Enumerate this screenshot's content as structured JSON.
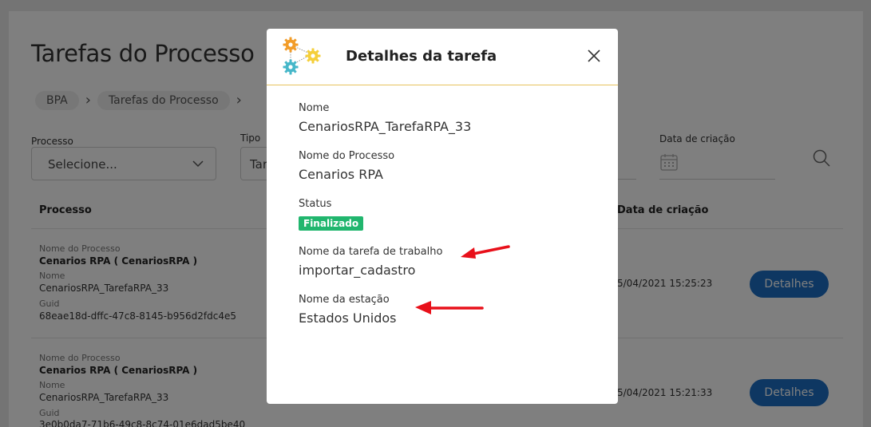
{
  "page": {
    "title": "Tarefas do Processo",
    "breadcrumb": [
      "BPA",
      "Tarefas do Processo"
    ],
    "filters": {
      "processo_label": "Processo",
      "processo_value": "Selecione...",
      "tipo_label": "Tipo",
      "tipo_value": "Tar",
      "data_label": "Data de criação"
    },
    "table": {
      "headers": {
        "processo": "Processo",
        "data": "Data de criação"
      },
      "rows": [
        {
          "nome_processo_label": "Nome do Processo",
          "nome_processo": "Cenarios RPA ( CenariosRPA )",
          "nome_label": "Nome",
          "nome": "CenariosRPA_TarefaRPA_33",
          "guid_label": "Guid",
          "guid": "68eae18d-dffc-47c8-8145-b956d2fdc4e5",
          "data": "5/04/2021 15:25:23",
          "button": "Detalhes"
        },
        {
          "nome_processo_label": "Nome do Processo",
          "nome_processo": "Cenarios RPA ( CenariosRPA )",
          "nome_label": "Nome",
          "nome": "CenariosRPA_TarefaRPA_33",
          "guid_label": "Guid",
          "guid": "3e0b0da7-71b6-49c8-8c74-01e6dad5be40",
          "data": "5/04/2021 15:21:33",
          "button": "Detalhes"
        }
      ]
    }
  },
  "modal": {
    "title": "Detalhes da tarefa",
    "fields": {
      "nome_label": "Nome",
      "nome_value": "CenariosRPA_TarefaRPA_33",
      "processo_label": "Nome do Processo",
      "processo_value": "Cenarios RPA",
      "status_label": "Status",
      "status_value": "Finalizado",
      "tarefa_label": "Nome da tarefa de trabalho",
      "tarefa_value": "importar_cadastro",
      "estacao_label": "Nome da estação",
      "estacao_value": "Estados Unidos"
    }
  },
  "colors": {
    "accent_blue": "#1c6fc4",
    "status_green": "#21b66e",
    "annotation_red": "#e8101a",
    "header_divider": "#e6c25e"
  },
  "icons": [
    "chevron-down-icon",
    "calendar-icon",
    "search-icon",
    "gears-logo-icon",
    "close-icon",
    "red-arrow-icon"
  ]
}
